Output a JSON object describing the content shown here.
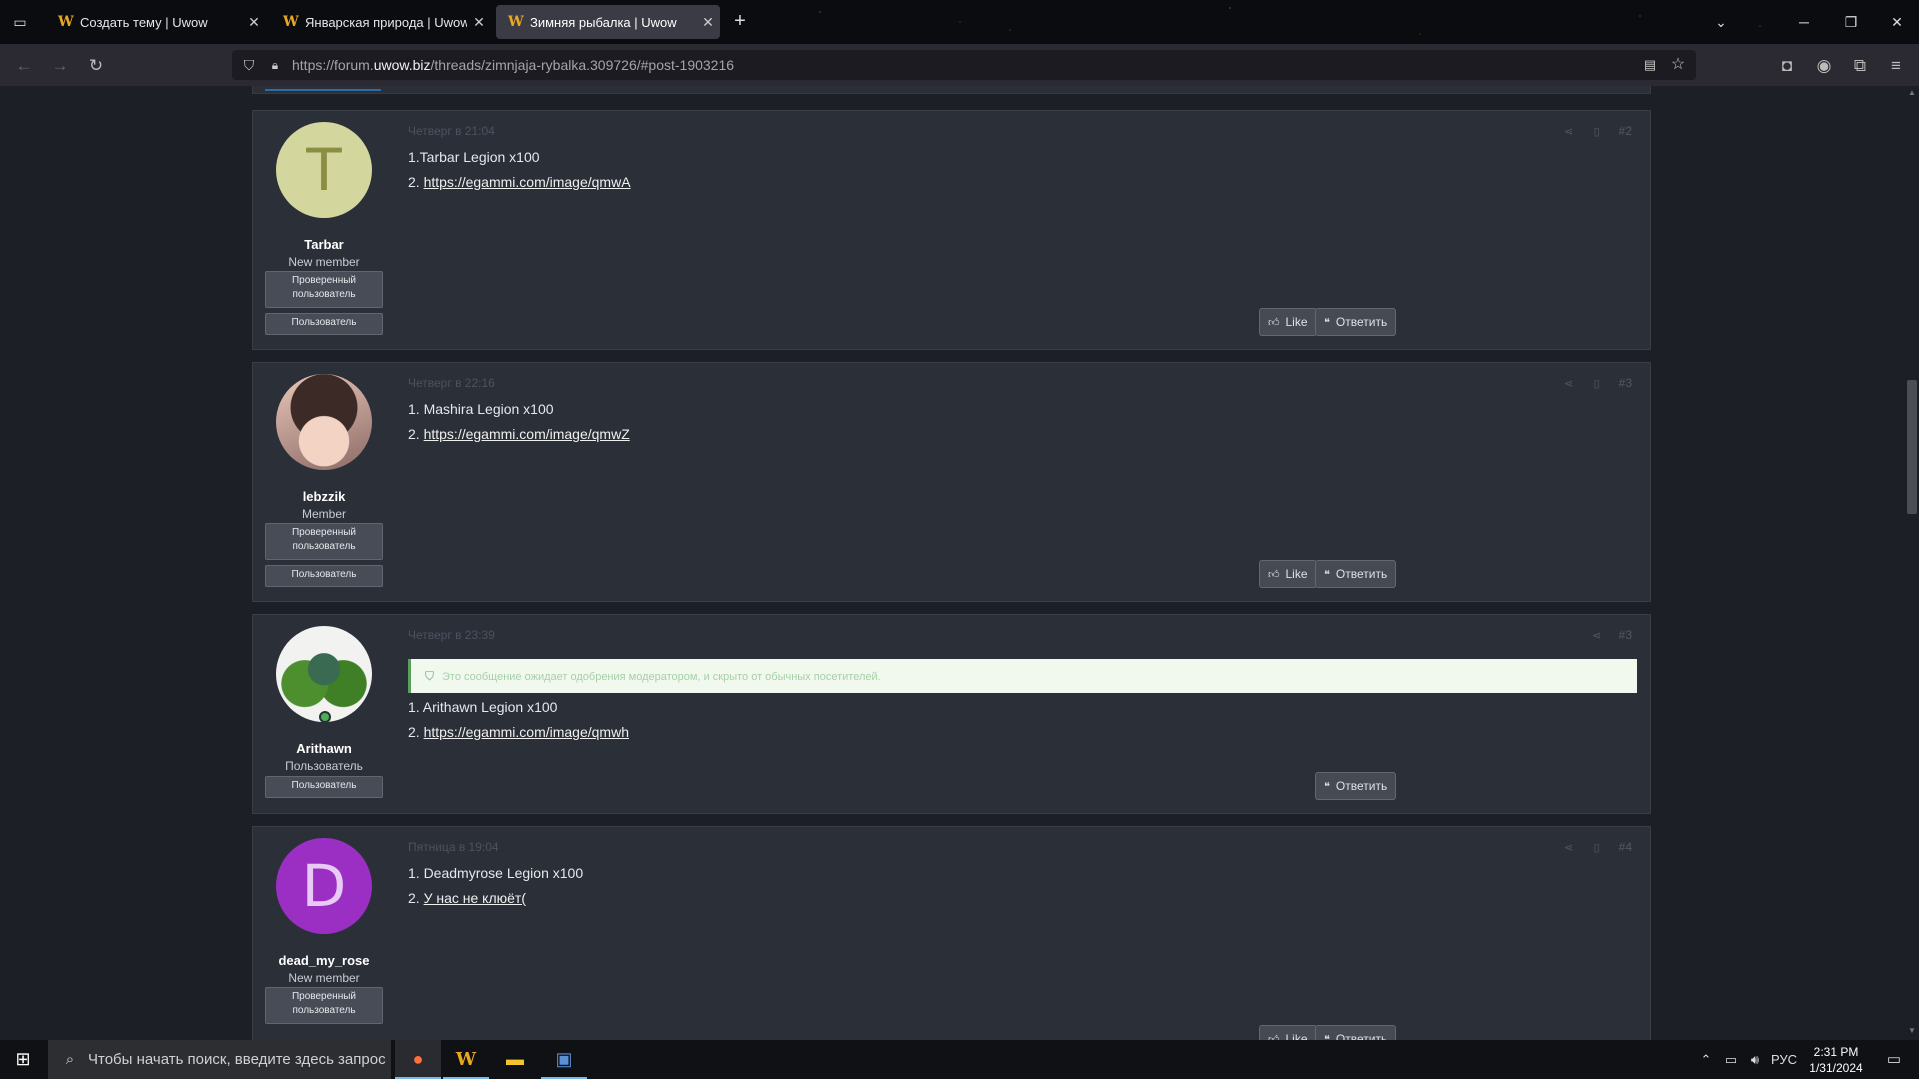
{
  "browser": {
    "tabs": [
      {
        "title": "Создать тему | Uwow",
        "favicon": "W",
        "active": false
      },
      {
        "title": "Январская природа | Uwow",
        "favicon": "W",
        "active": false
      },
      {
        "title": "Зимняя рыбалка | Uwow",
        "favicon": "W",
        "active": true
      }
    ],
    "url_prefix": "https://forum.",
    "url_domain": "uwow.biz",
    "url_path": "/threads/zimnjaja-rybalka.309726/#post-1903216",
    "new_tab": "+"
  },
  "posts": [
    {
      "avatar_letter": "T",
      "avatar_bg": "#d3d79e",
      "avatar_fg": "#8a8d42",
      "username": "Tarbar",
      "user_title": "New member",
      "banners": [
        "Проверенный пользователь",
        "Пользователь"
      ],
      "date": "Четверг в 21:04",
      "number": "#2",
      "line1": "1.Tarbar Legion x100",
      "line2_prefix": "2. ",
      "line2_link": "https://egammi.com/image/qmwA",
      "like": "Like",
      "reply": "Ответить"
    },
    {
      "avatar_letter": "",
      "username": "lebzzik",
      "user_title": "Member",
      "banners": [
        "Проверенный пользователь",
        "Пользователь"
      ],
      "date": "Четверг в 22:16",
      "number": "#3",
      "line1": "1. Mashira Legion x100",
      "line2_prefix": "2. ",
      "line2_link": "https://egammi.com/image/qmwZ",
      "like": "Like",
      "reply": "Ответить"
    },
    {
      "avatar_letter": "",
      "username": "Arithawn",
      "user_title": "Пользователь",
      "banners": [
        "Пользователь"
      ],
      "date": "Четверг в 23:39",
      "number": "#3",
      "moderation_note": "Это сообщение ожидает одобрения модератором, и скрыто от обычных посетителей.",
      "line1": "1. Arithawn Legion x100",
      "line2_prefix": "2. ",
      "line2_link": "https://egammi.com/image/qmwh",
      "reply": "Ответить"
    },
    {
      "avatar_letter": "D",
      "avatar_bg": "#9b2fc4",
      "avatar_fg": "#e9c9f5",
      "username": "dead_my_rose",
      "user_title": "New member",
      "banners": [
        "Проверенный пользователь"
      ],
      "date": "Пятница в 19:04",
      "number": "#4",
      "line1": "1. Deadmyrose Legion x100",
      "line2_prefix": "2. ",
      "line2_link": "У нас не клюёт(",
      "like": "Like",
      "reply": "Ответить"
    }
  ],
  "taskbar": {
    "search_placeholder": "Чтобы начать поиск, введите здесь запрос",
    "language": "РУС",
    "time": "2:31 PM",
    "date": "1/31/2024"
  },
  "colors": {
    "accent": "#2e6da4",
    "page_bg": "#1c2026",
    "post_bg": "#2b2f38",
    "button_bg": "#454a53"
  }
}
